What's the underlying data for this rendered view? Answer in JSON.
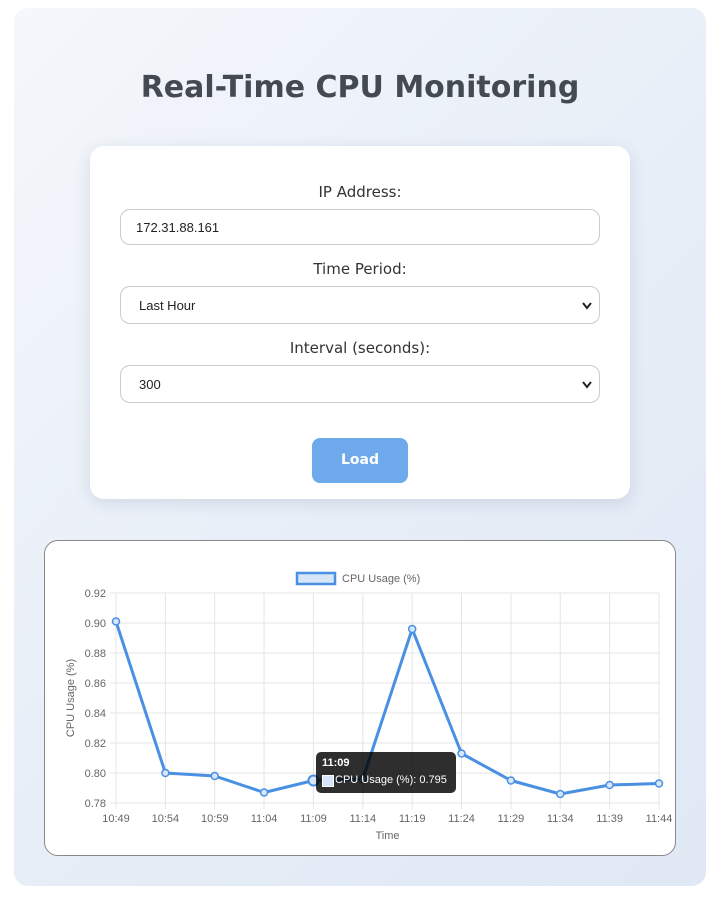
{
  "page": {
    "title": "Real-Time CPU Monitoring"
  },
  "form": {
    "ip_label": "IP Address:",
    "ip_value": "172.31.88.161",
    "period_label": "Time Period:",
    "period_value": "Last Hour",
    "interval_label": "Interval (seconds):",
    "interval_value": "300",
    "load_label": "Load"
  },
  "tooltip": {
    "title": "11:09",
    "label": "CPU Usage (%): 0.795"
  },
  "colors": {
    "line": "#4a90e2",
    "fill": "#d6e5f7",
    "button": "#6eaaeb"
  },
  "chart_data": {
    "type": "line",
    "categories": [
      "10:49",
      "10:54",
      "10:59",
      "11:04",
      "11:09",
      "11:14",
      "11:19",
      "11:24",
      "11:29",
      "11:34",
      "11:39",
      "11:44"
    ],
    "series": [
      {
        "name": "CPU Usage (%)",
        "values": [
          0.901,
          0.8,
          0.798,
          0.787,
          0.795,
          0.796,
          0.896,
          0.813,
          0.795,
          0.786,
          0.792,
          0.793
        ]
      }
    ],
    "xlabel": "Time",
    "ylabel": "CPU Usage (%)",
    "ylim": [
      0.78,
      0.92
    ],
    "yticks": [
      "0.92",
      "0.90",
      "0.88",
      "0.86",
      "0.84",
      "0.82",
      "0.80",
      "0.78"
    ],
    "grid": true,
    "legend": "top-center",
    "highlighted_index": 4
  }
}
